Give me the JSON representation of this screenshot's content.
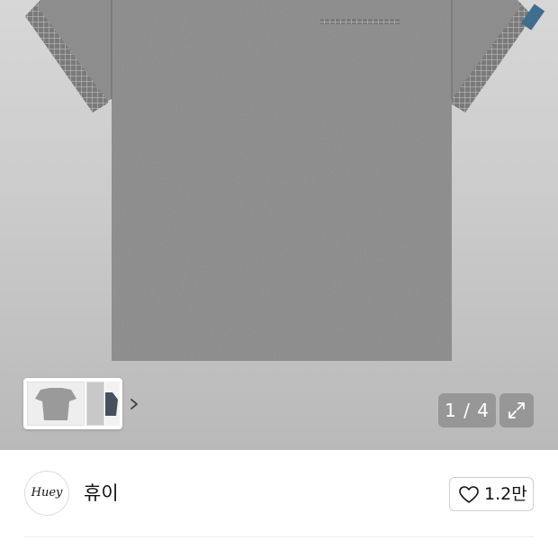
{
  "gallery": {
    "counter_text": "1 / 4",
    "thumbnail_count": 3,
    "current_image": 1,
    "total_images": 4,
    "shirt_color": "#8a8a8a",
    "trim_color": "#6f6f6f",
    "accent_color": "#3f6e8f"
  },
  "shop": {
    "logo_text": "Huey",
    "name": "휴이",
    "like_count": "1.2만"
  },
  "icons": {
    "expand": "expand-icon",
    "heart": "heart-outline-icon",
    "chevron": "chevron-right-icon"
  }
}
